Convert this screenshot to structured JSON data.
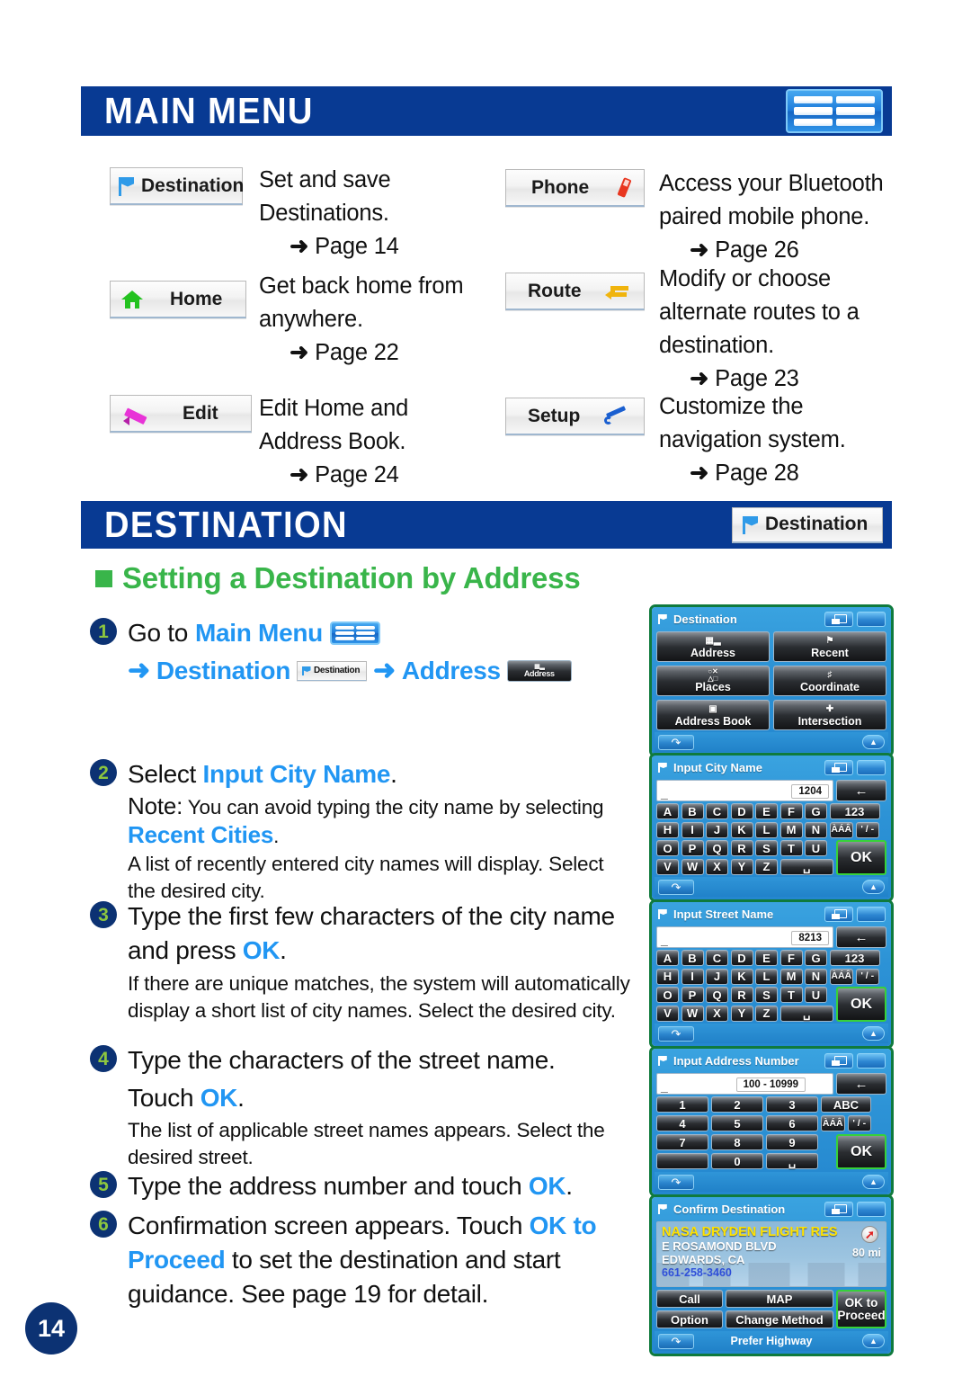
{
  "page_number": "14",
  "sections": {
    "main_menu": {
      "title": "MAIN MENU",
      "icon": "main-menu-grid-icon",
      "items": [
        {
          "button_label": "Destination",
          "icon": "flag-icon",
          "description": "Set and save Destinations.",
          "page_ref": "Page 14"
        },
        {
          "button_label": "Home",
          "icon": "house-icon",
          "description": "Get back home from anywhere.",
          "page_ref": "Page 22"
        },
        {
          "button_label": "Edit",
          "icon": "pencil-icon",
          "description": "Edit Home and Address Book.",
          "page_ref": "Page 24"
        },
        {
          "button_label": "Phone",
          "icon": "mobile-phone-icon",
          "description": "Access your Bluetooth paired mobile phone.",
          "page_ref": "Page 26"
        },
        {
          "button_label": "Route",
          "icon": "route-arrow-icon",
          "description": "Modify or choose alternate routes to a destination.",
          "page_ref": "Page 23"
        },
        {
          "button_label": "Setup",
          "icon": "wrench-icon",
          "description": "Customize the navigation system.",
          "page_ref": "Page 28"
        }
      ]
    },
    "destination": {
      "title": "DESTINATION",
      "header_button_label": "Destination",
      "subheading": "Setting a Destination by Address",
      "steps": [
        {
          "num": "1",
          "line1_pre": "Go to ",
          "line1_hl": "Main Menu",
          "line2_arrow1": "➜",
          "line2_hl1": "Destination",
          "line2_chip1": "Destination",
          "line2_arrow2": "➜",
          "line2_hl2": "Address",
          "line2_chip2": "Address"
        },
        {
          "num": "2",
          "lead_pre": "Select ",
          "lead_hl": "Input City Name",
          "lead_post": ".",
          "note_label": "Note:",
          "note_text": " You can avoid typing the city name by selecting ",
          "note_hl": "Recent Cities",
          "note_post": ".",
          "detail": "A list of recently entered city names will display. Select the desired city."
        },
        {
          "num": "3",
          "lead_pre": "Type the first few characters of the city name and press ",
          "lead_hl": "OK",
          "lead_post": ".",
          "detail": "If there are unique matches, the system will automatically display a short list of city names. Select the desired city."
        },
        {
          "num": "4",
          "lead_pre": "Type the characters of the street name.",
          "lead2_pre": "Touch ",
          "lead2_hl": "OK",
          "lead2_post": ".",
          "detail": "The list of applicable street names appears. Select the desired street."
        },
        {
          "num": "5",
          "lead_pre": "Type the address number and touch ",
          "lead_hl": "OK",
          "lead_post": "."
        },
        {
          "num": "6",
          "lead_pre": "Confirmation screen appears. Touch ",
          "lead_hl": "OK to Proceed",
          "lead_post": " to set the destination and start guidance. See page 19 for detail."
        }
      ]
    }
  },
  "nav_screens": [
    {
      "id": "destination-menu",
      "title": "Destination",
      "buttons": [
        {
          "label": "Address",
          "icon": "address-building-icon"
        },
        {
          "label": "Recent",
          "icon": "flag-icon"
        },
        {
          "label": "Places",
          "icon": "places-shapes-icon"
        },
        {
          "label": "Coordinate",
          "icon": "coordinate-grid-icon"
        },
        {
          "label": "Address Book",
          "icon": "book-icon"
        },
        {
          "label": "Intersection",
          "icon": "intersection-icon"
        }
      ],
      "back_icon": "back-arrow-icon",
      "up_icon": "up-arrow-icon"
    },
    {
      "id": "input-city-name",
      "title": "Input City Name",
      "input_value": "_",
      "count": "1204",
      "backspace_icon": "backspace-arrow-icon",
      "rows": [
        [
          "A",
          "B",
          "C",
          "D",
          "E",
          "F",
          "G"
        ],
        [
          "H",
          "I",
          "J",
          "K",
          "L",
          "M",
          "N"
        ],
        [
          "O",
          "P",
          "Q",
          "R",
          "S",
          "T",
          "U"
        ],
        [
          "V",
          "W",
          "X",
          "Y",
          "Z"
        ]
      ],
      "space_label": "␣",
      "side_keys": {
        "mode": "123",
        "accent": "ÀÁÂ",
        "symbol": "' / -",
        "ok": "OK"
      },
      "back_icon": "back-arrow-icon",
      "up_icon": "up-arrow-icon"
    },
    {
      "id": "input-street-name",
      "title": "Input Street Name",
      "input_value": "_",
      "count": "8213",
      "backspace_icon": "backspace-arrow-icon",
      "rows": [
        [
          "A",
          "B",
          "C",
          "D",
          "E",
          "F",
          "G"
        ],
        [
          "H",
          "I",
          "J",
          "K",
          "L",
          "M",
          "N"
        ],
        [
          "O",
          "P",
          "Q",
          "R",
          "S",
          "T",
          "U"
        ],
        [
          "V",
          "W",
          "X",
          "Y",
          "Z"
        ]
      ],
      "space_label": "␣",
      "side_keys": {
        "mode": "123",
        "accent": "ÀÁÂ",
        "symbol": "' / -",
        "ok": "OK"
      },
      "back_icon": "back-arrow-icon",
      "up_icon": "up-arrow-icon"
    },
    {
      "id": "input-address-number",
      "title": "Input Address Number",
      "input_value": "_",
      "count": "100 - 10999",
      "backspace_icon": "backspace-arrow-icon",
      "rows": [
        [
          "1",
          "2",
          "3"
        ],
        [
          "4",
          "5",
          "6"
        ],
        [
          "7",
          "8",
          "9"
        ],
        [
          "",
          "0",
          "␣"
        ]
      ],
      "side_keys": {
        "mode": "ABC",
        "accent": "ÀÁÂ",
        "symbol": "' / -",
        "ok": "OK"
      },
      "back_icon": "back-arrow-icon",
      "up_icon": "up-arrow-icon"
    },
    {
      "id": "confirm-destination",
      "title": "Confirm Destination",
      "poi_name": "NASA DRYDEN FLIGHT RES",
      "poi_street": "E ROSAMOND BLVD",
      "poi_city": "EDWARDS, CA",
      "poi_phone": "661-258-3460",
      "distance": "80 mi",
      "compass_icon": "compass-arrow-icon",
      "buttons": {
        "call": "Call",
        "map": "MAP",
        "option": "Option",
        "change_method": "Change Method",
        "ok_line1": "OK  to",
        "ok_line2": "Proceed"
      },
      "footer": "Prefer Highway",
      "back_icon": "back-arrow-icon",
      "up_icon": "up-arrow-icon"
    }
  ],
  "colors": {
    "header_blue": "#083a93",
    "accent_blue": "#2196f3",
    "green": "#39b54a",
    "badge_navy": "#0c3273",
    "badge_green_text": "#8dc63f"
  }
}
